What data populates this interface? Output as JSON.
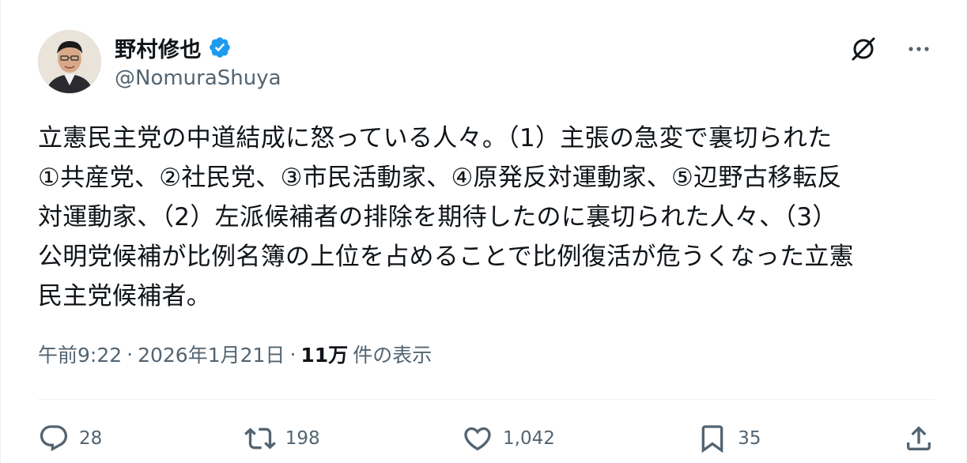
{
  "author": {
    "display_name": "野村修也",
    "handle": "@NomuraShuya",
    "verified": true
  },
  "icons": {
    "verified": "verified-badge-icon",
    "grok": "grok-icon",
    "more": "more-icon",
    "reply": "reply-icon",
    "repost": "repost-icon",
    "like": "like-icon",
    "bookmark": "bookmark-icon",
    "share": "share-icon"
  },
  "tweet": {
    "text": "立憲民主党の中道結成に怒っている人々。（1）主張の急変で裏切られた\n①共産党、②社民党、③市民活動家、④原発反対運動家、⑤辺野古移転反\n対運動家、（2）左派候補者の排除を期待したのに裏切られた人々、（3）\n公明党候補が比例名簿の上位を占めることで比例復活が危うくなった立憲\n民主党候補者。"
  },
  "meta": {
    "time": "午前9:22",
    "separator": "·",
    "date": "2026年1月21日",
    "views_count": "11万",
    "views_label": "件の表示"
  },
  "engagement": {
    "replies": "28",
    "reposts": "198",
    "likes": "1,042",
    "bookmarks": "35"
  },
  "colors": {
    "text_primary": "#0f1419",
    "text_secondary": "#536471",
    "verified_blue": "#1d9bf0",
    "divider": "#eff3f4"
  }
}
